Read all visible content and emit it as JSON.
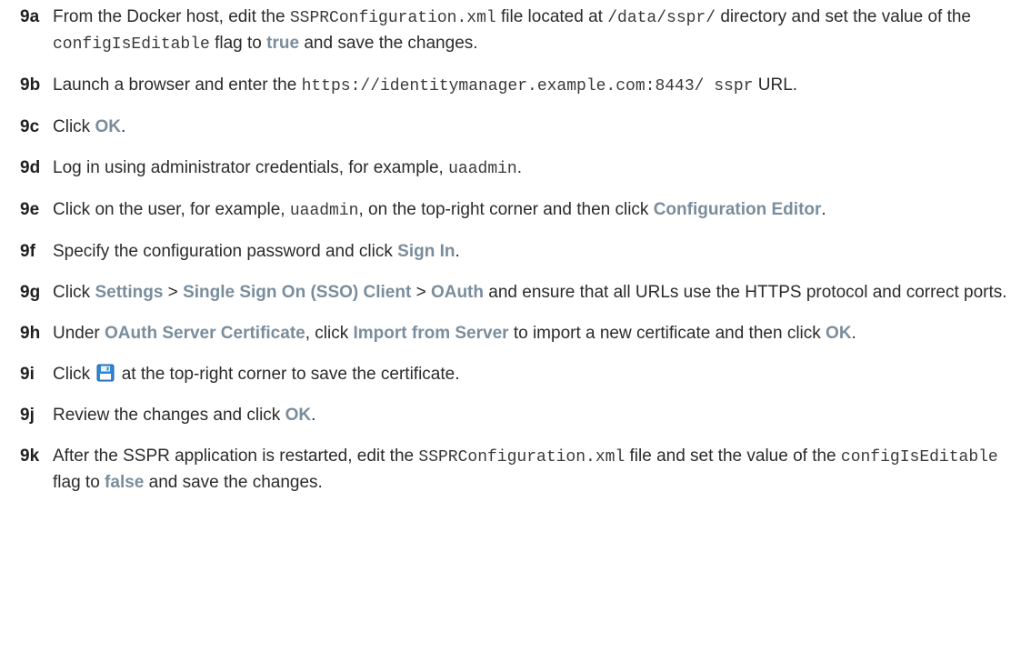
{
  "steps": [
    {
      "label": "9a",
      "t1": "From the Docker host, edit the ",
      "c1": "SSPRConfiguration.xml",
      "t2": " file located at ",
      "c2": "/data/sspr/",
      "t3": " directory and set the value of the ",
      "c3": "configIsEditable",
      "t4": " flag to ",
      "b1": "true",
      "t5": " and save the changes."
    },
    {
      "label": "9b",
      "t1": "Launch a browser and enter the ",
      "c1": "https://identitymanager.example.com:8443/ sspr",
      "t2": " URL."
    },
    {
      "label": "9c",
      "t1": "Click ",
      "b1": "OK",
      "t2": "."
    },
    {
      "label": "9d",
      "t1": "Log in using administrator credentials, for example, ",
      "c1": "uaadmin",
      "t2": "."
    },
    {
      "label": "9e",
      "t1": "Click on the user, for example, ",
      "c1": "uaadmin",
      "t2": ", on the top-right corner and then click ",
      "b1": "Configuration Editor",
      "t3": "."
    },
    {
      "label": "9f",
      "t1": "Specify the configuration password and click ",
      "b1": "Sign In",
      "t2": "."
    },
    {
      "label": "9g",
      "t1": "Click ",
      "b1": "Settings",
      "t2": " > ",
      "b2": "Single Sign On (SSO) Client",
      "t3": " > ",
      "b3": "OAuth",
      "t4": " and ensure that all URLs use the HTTPS protocol and correct ports."
    },
    {
      "label": "9h",
      "t1": "Under ",
      "b1": "OAuth Server Certificate",
      "t2": ", click ",
      "b2": "Import from Server",
      "t3": " to import a new certificate and then click ",
      "b3": "OK",
      "t4": "."
    },
    {
      "label": "9i",
      "t1": "Click ",
      "icon": "save-icon",
      "t2": " at the top-right corner to save the certificate."
    },
    {
      "label": "9j",
      "t1": "Review the changes and click ",
      "b1": "OK",
      "t2": "."
    },
    {
      "label": "9k",
      "t1": "After the SSPR application is restarted, edit the ",
      "c1": "SSPRConfiguration.xml",
      "t2": " file and set the value of the ",
      "c2": "configIsEditable",
      "t3": " flag to ",
      "b1": "false",
      "t4": " and save the changes."
    }
  ],
  "colors": {
    "ui_text": "#7a8d9c",
    "icon_blue": "#2f86d6"
  }
}
